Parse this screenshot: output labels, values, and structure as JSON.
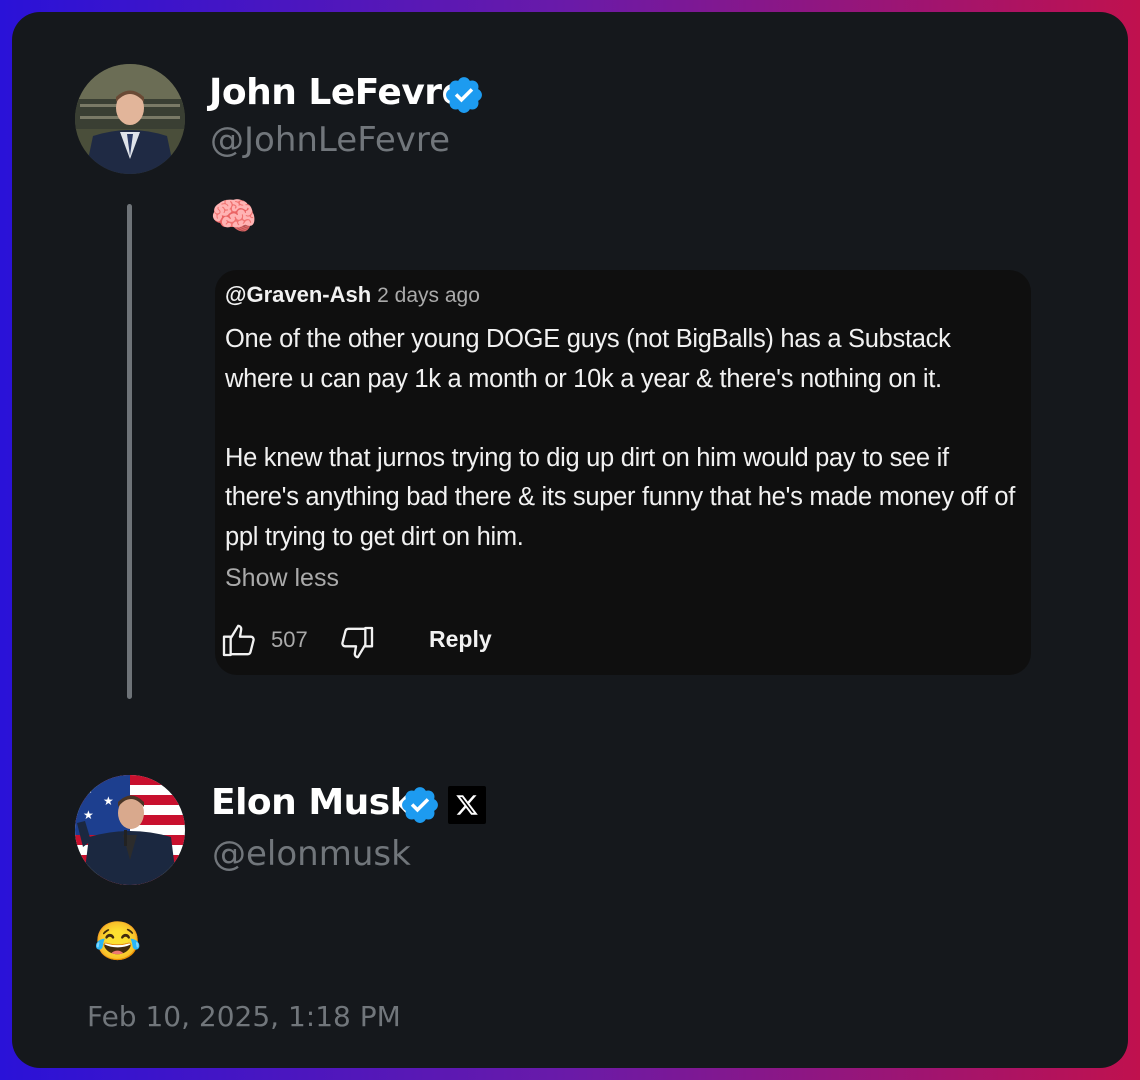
{
  "posts": [
    {
      "author": {
        "name": "John LeFevre",
        "handle": "@JohnLeFevre",
        "verified": true,
        "avatar_icon": "profile-photo-man-in-suit"
      },
      "text_emoji": "🧠",
      "embedded_comment": {
        "author": "@Graven-Ash",
        "time": "2 days ago",
        "paragraphs": [
          "One of the other young DOGE guys (not BigBalls) has a Substack where u can pay 1k a month or 10k a year & there's nothing on it.",
          "He knew that jurnos trying to dig up dirt on him would pay to see if there's anything bad there & its super funny that he's made money off of ppl trying to get dirt on him."
        ],
        "show_less": "Show less",
        "likes": "507",
        "reply_label": "Reply"
      }
    },
    {
      "author": {
        "name": "Elon Musk",
        "handle": "@elonmusk",
        "verified": true,
        "affiliation_icon": "x-logo-icon",
        "avatar_icon": "profile-photo-man-with-flag"
      },
      "text_emoji": "😂",
      "timestamp": "Feb 10, 2025, 1:18 PM"
    }
  ],
  "colors": {
    "card_bg": "#15181c",
    "verified_blue": "#1d9bf0",
    "handle_gray": "#71767b",
    "yt_bg": "#0f0f0f"
  }
}
